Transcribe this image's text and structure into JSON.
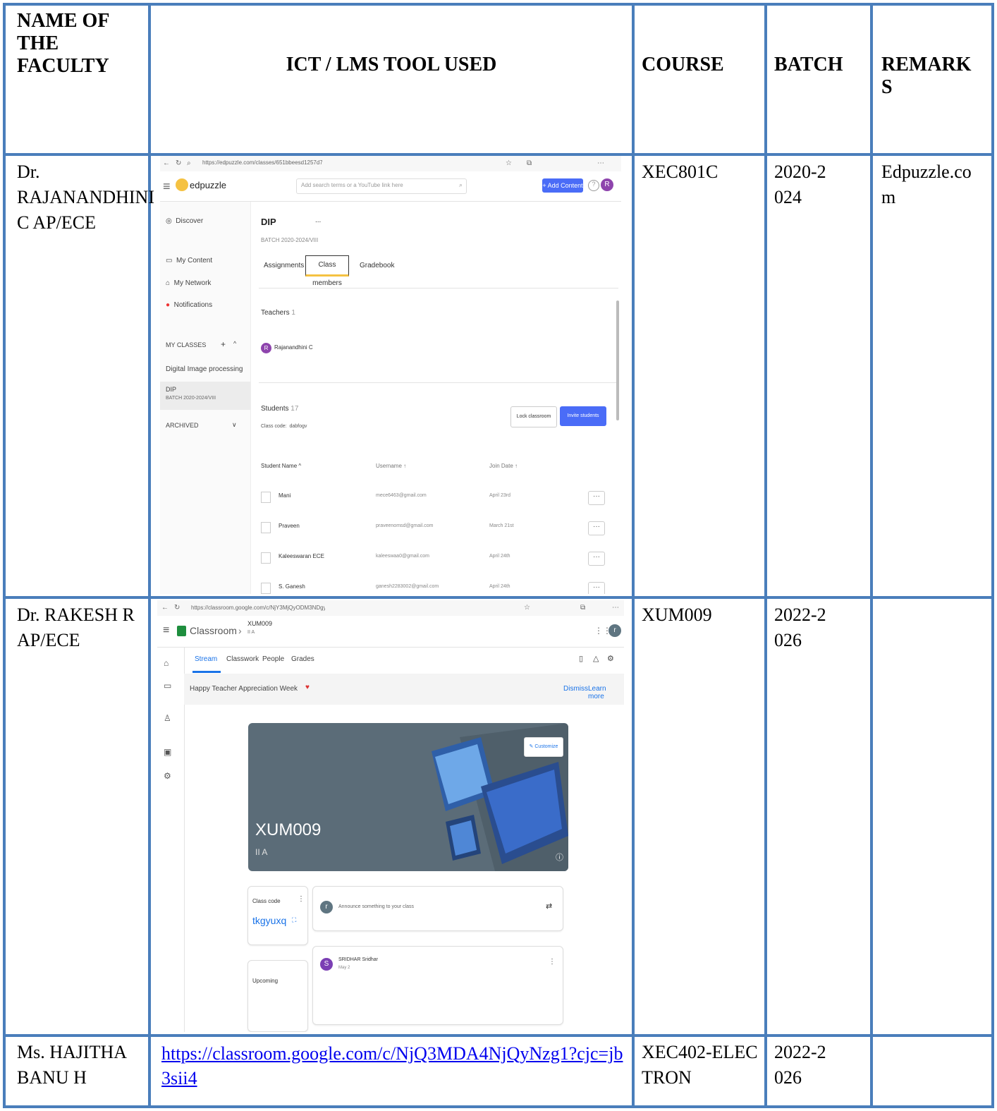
{
  "headers": {
    "faculty": "NAME OF THE FACULTY",
    "tool": "ICT / LMS TOOL USED",
    "course": "COURSE",
    "batch": "BATCH",
    "remarks": "REMARKS"
  },
  "rows": [
    {
      "faculty": "Dr. RAJANANDHINI C AP/ECE",
      "course": "XEC801C",
      "batch": "2020-2024",
      "remarks": "Edpuzzle.com"
    },
    {
      "faculty": "Dr. RAKESH R AP/ECE",
      "course": "XUM009",
      "batch": "2022-2026",
      "remarks": ""
    },
    {
      "faculty": "Ms. HAJITHA BANU H",
      "tool_link": "https://classroom.google.com/c/NjQ3MDA4NjQyNzg1?cjc=jb3sii4",
      "course": "XEC402-ELECTRON",
      "batch": "2022-2026",
      "remarks": ""
    }
  ],
  "edpuzzle": {
    "url": "https://edpuzzle.com/classes/651bbeesd1257d7d3c3d5e72",
    "logo": "edpuzzle",
    "search_placeholder": "Add search terms or a YouTube link here",
    "add_content": "+ Add Content",
    "user_initial": "R",
    "sidebar": {
      "discover": "Discover",
      "my_content": "My Content",
      "my_network": "My Network",
      "notifications": "Notifications",
      "my_classes": "MY CLASSES",
      "class1": "Digital Image processing",
      "class2": "DIP",
      "class2_sub": "BATCH 2020-2024/VIII",
      "archived": "ARCHIVED"
    },
    "class_title": "DIP",
    "class_menu": "...",
    "class_sub": "BATCH 2020-2024/VIII",
    "tabs": [
      "Assignments",
      "Class members",
      "Gradebook"
    ],
    "teachers_label": "Teachers",
    "teachers_count": "1",
    "teacher_name": "Rajanandhini C",
    "students_label": "Students",
    "students_count": "17",
    "class_code_label": "Class code:",
    "class_code": "dabfogv",
    "lock_classroom": "Lock classroom",
    "invite_students": "Invite students",
    "col_name": "Student Name",
    "col_username": "Username",
    "col_join": "Join Date",
    "students": [
      {
        "name": "Mani",
        "username": "mece6463@gmail.com",
        "join": "April 23rd"
      },
      {
        "name": "Praveen",
        "username": "praveenomsd@gmail.com",
        "join": "March 21st"
      },
      {
        "name": "Kaleeswaran ECE",
        "username": "kaleeswaa0@gmail.com",
        "join": "April 24th"
      },
      {
        "name": "S. Ganesh",
        "username": "ganesh2283002@gmail.com",
        "join": "April 24th"
      }
    ]
  },
  "classroom": {
    "url": "https://classroom.google.com/c/NjY3MjQyODM3NDgy",
    "app_name": "Classroom",
    "course_code": "XUM009",
    "section": "II A",
    "user_initial": "r",
    "tabs": [
      "Stream",
      "Classwork",
      "People",
      "Grades"
    ],
    "banner_text": "Happy Teacher Appreciation Week",
    "dismiss": "Dismiss",
    "learn_more": "Learn more",
    "customize": "Customize",
    "hero_title": "XUM009",
    "hero_sub": "II A",
    "class_code_label": "Class code",
    "class_code": "tkgyuxq",
    "announce_placeholder": "Announce something to your class",
    "post_author": "SRIDHAR Sridhar",
    "post_date": "May 2",
    "post_initial": "S",
    "upcoming": "Upcoming",
    "announce_initial": "r"
  },
  "colors": {
    "border": "#4a7ebb",
    "link": "#0000ee",
    "edpuzzle_blue": "#4a6cf7",
    "avatar_purple": "#8e44ad"
  }
}
